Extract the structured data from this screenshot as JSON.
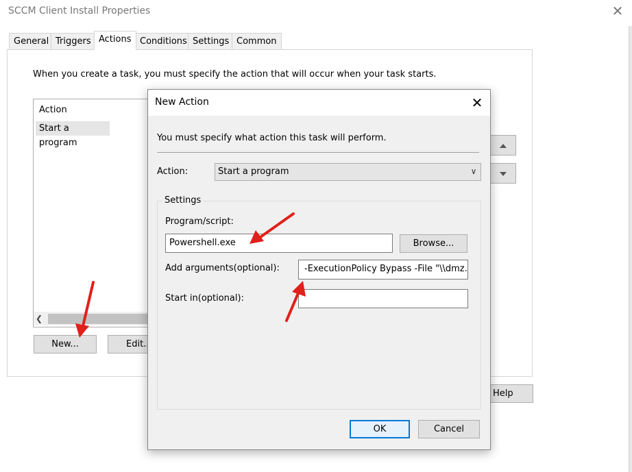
{
  "window": {
    "title": "SCCM Client Install Properties",
    "close_glyph": "✕",
    "tabs": [
      {
        "label": "General"
      },
      {
        "label": "Triggers"
      },
      {
        "label": "Actions"
      },
      {
        "label": "Conditions"
      },
      {
        "label": "Settings"
      },
      {
        "label": "Common"
      }
    ],
    "active_tab": "Actions",
    "description": "When you create a task, you must specify the action that will occur when your task starts.",
    "actions_list": {
      "header": "Action",
      "rows": [
        {
          "action": "Start a program"
        }
      ]
    },
    "new_label": "New...",
    "edit_label": "Edit...",
    "help_label": "Help"
  },
  "dialog": {
    "title": "New Action",
    "close_glyph": "✕",
    "instruction": "You must specify what action this task will perform.",
    "action_label": "Action:",
    "action_value": "Start a program",
    "settings_label": "Settings",
    "program_label": "Program/script:",
    "program_value": "Powershell.exe",
    "browse_label": "Browse...",
    "arguments_label": "Add arguments(optional):",
    "arguments_value": "-ExecutionPolicy Bypass -File \"\\\\dmz.cor",
    "startin_label": "Start in(optional):",
    "startin_value": "",
    "ok_label": "OK",
    "cancel_label": "Cancel"
  },
  "annotation_color": "#e0201b"
}
